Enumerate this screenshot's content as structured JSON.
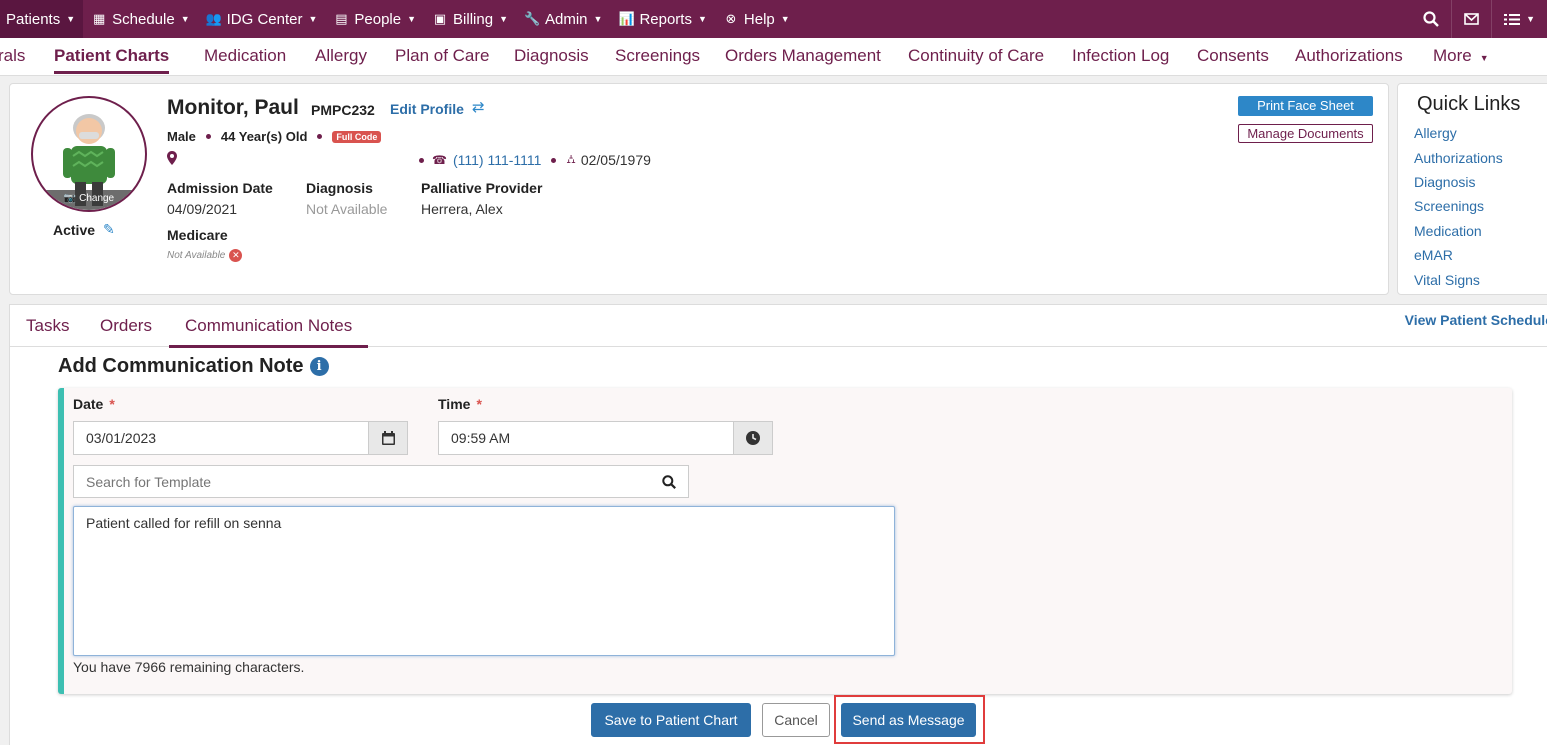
{
  "topnav": {
    "items": [
      {
        "label": "Patients",
        "icon": "none"
      },
      {
        "label": "Schedule",
        "icon": "calendar-icon"
      },
      {
        "label": "IDG Center",
        "icon": "users-icon"
      },
      {
        "label": "People",
        "icon": "id-card-icon"
      },
      {
        "label": "Billing",
        "icon": "money-icon"
      },
      {
        "label": "Admin",
        "icon": "wrench-icon"
      },
      {
        "label": "Reports",
        "icon": "bar-chart-icon"
      },
      {
        "label": "Help",
        "icon": "help-icon"
      }
    ],
    "right_icons": [
      "search-icon",
      "mail-icon",
      "list-menu-icon"
    ]
  },
  "subnav": {
    "tabs": [
      "rals",
      "Patient Charts",
      "Medication",
      "Allergy",
      "Plan of Care",
      "Diagnosis",
      "Screenings",
      "Orders Management",
      "Continuity of Care",
      "Infection Log",
      "Consents",
      "Authorizations",
      "More"
    ],
    "active": "Patient Charts"
  },
  "patient": {
    "name": "Monitor, Paul",
    "code": "PMPC232",
    "edit_profile": "Edit Profile",
    "gender": "Male",
    "age": "44 Year(s) Old",
    "code_status": "Full Code",
    "phone": "(111) 111-1111",
    "dob": "02/05/1979",
    "status": "Active",
    "avatar_change": "Change",
    "admission_label": "Admission Date",
    "admission_value": "04/09/2021",
    "diagnosis_label": "Diagnosis",
    "diagnosis_value": "Not Available",
    "provider_label": "Palliative Provider",
    "provider_value": "Herrera, Alex",
    "medicare_label": "Medicare",
    "medicare_value": "Not Available",
    "print_face_sheet": "Print Face Sheet",
    "manage_documents": "Manage Documents"
  },
  "quick_links": {
    "title": "Quick Links",
    "items": [
      "Allergy",
      "Authorizations",
      "Diagnosis",
      "Screenings",
      "Medication",
      "eMAR",
      "Vital Signs"
    ]
  },
  "main": {
    "tabs": [
      "Tasks",
      "Orders",
      "Communication Notes"
    ],
    "active_tab": "Communication Notes",
    "view_schedule": "View Patient Schedule"
  },
  "form": {
    "title": "Add Communication Note",
    "date_label": "Date",
    "date_value": "03/01/2023",
    "time_label": "Time",
    "time_value": "09:59 AM",
    "template_placeholder": "Search for Template",
    "note_text": "Patient called for refill on senna",
    "remaining": "You have 7966 remaining characters.",
    "save_label": "Save to Patient Chart",
    "cancel_label": "Cancel",
    "send_label": "Send as Message"
  },
  "colors": {
    "brand": "#6e1f4c",
    "primary": "#2d6ea8",
    "accent_border": "#3dbfb2",
    "highlight": "#e03c3c"
  }
}
